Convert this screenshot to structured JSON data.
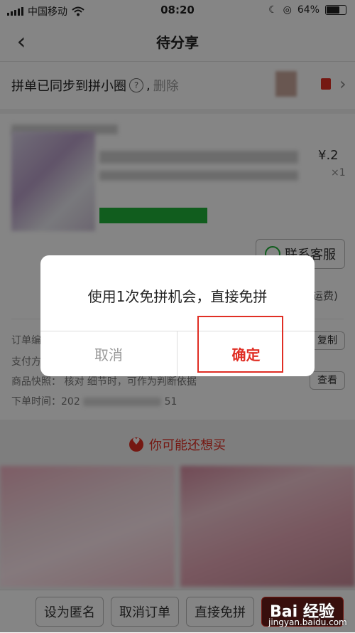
{
  "status_bar": {
    "carrier": "中国移动",
    "time": "08:20",
    "battery": "64%"
  },
  "nav": {
    "title": "待分享"
  },
  "sync_bar": {
    "text": "拼单已同步到拼小圈",
    "separator": ",",
    "delete_label": "删除"
  },
  "order_card": {
    "price_fragment": "¥.2",
    "quantity": "×1",
    "contact_service_label": "联系客服",
    "shipping_fragment": "运费)",
    "copy_label": "复制",
    "view_label": "查看",
    "snapshot_row": "商品快照：    核对     细节时，可作为判断依据",
    "order_time_label": "下单时间：202",
    "order_time_tail": "51"
  },
  "recommend": {
    "title": "你可能还想买"
  },
  "bottom_bar": {
    "anonymous_label": "设为匿名",
    "cancel_order_label": "取消订单",
    "free_group_label": "直接免拼"
  },
  "dialog": {
    "message": "使用1次免拼机会，直接免拼",
    "cancel_label": "取消",
    "confirm_label": "确定"
  },
  "watermark": {
    "brand": "Bai 经验",
    "url": "jingyan.baidu.com"
  },
  "colors": {
    "accent_red": "#e02e24",
    "green": "#22b33a",
    "overlay": "rgba(0,0,0,0.48)"
  },
  "icons": [
    "back-chevron-icon",
    "wifi-icon",
    "help-icon",
    "chat-icon",
    "heart-icon",
    "red-packet-icon"
  ]
}
